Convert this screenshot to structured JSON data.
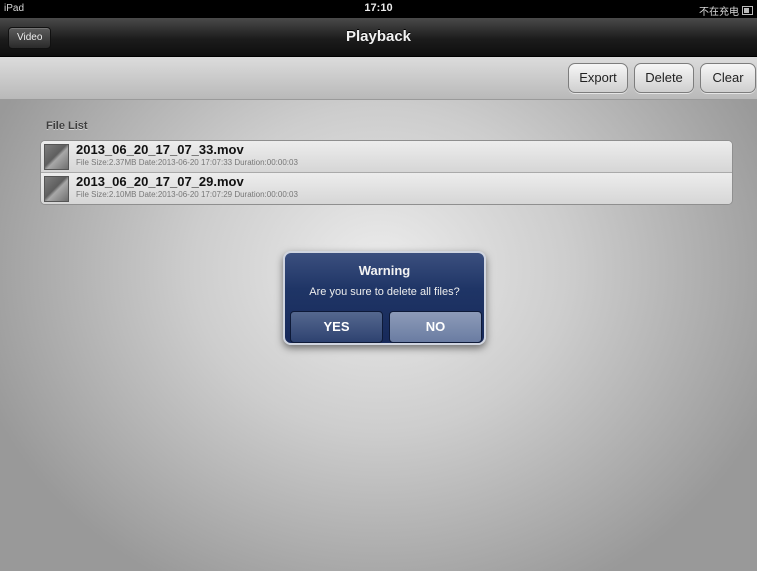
{
  "status_bar": {
    "carrier": "iPad",
    "time": "17:10",
    "battery_text": "不在充电"
  },
  "nav": {
    "back_label": "Video",
    "title": "Playback"
  },
  "toolbar": {
    "export_label": "Export",
    "delete_label": "Delete",
    "clear_label": "Clear"
  },
  "file_list": {
    "label": "File List",
    "files": [
      {
        "name": "2013_06_20_17_07_33.mov",
        "meta": "File Size:2.37MB Date:2013-06-20 17:07:33 Duration:00:00:03"
      },
      {
        "name": "2013_06_20_17_07_29.mov",
        "meta": "File Size:2.10MB Date:2013-06-20 17:07:29 Duration:00:00:03"
      }
    ]
  },
  "alert": {
    "title": "Warning",
    "message": "Are you sure to delete all files?",
    "yes_label": "YES",
    "no_label": "NO"
  },
  "icons": {
    "battery": "battery-icon",
    "thumbnail": "video-thumbnail-icon"
  },
  "colors": {
    "alert_background": "#1f3566",
    "navbar_background": "#1c1c1c"
  }
}
